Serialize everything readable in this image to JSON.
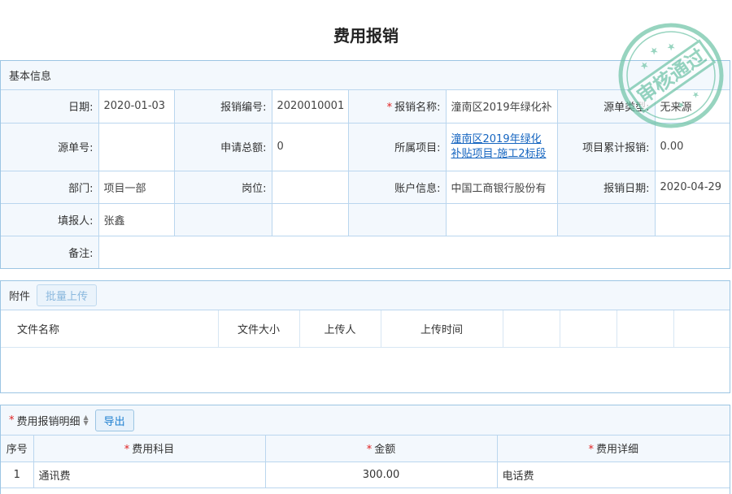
{
  "page": {
    "title": "费用报销"
  },
  "basic": {
    "header": "基本信息",
    "date_label": "日期:",
    "date": "2020-01-03",
    "number_label": "报销编号:",
    "number": "2020010001",
    "name_label": "报销名称:",
    "name": "潼南区2019年绿化补",
    "src_type_label": "源单类型:",
    "src_type": "无来源",
    "src_no_label": "源单号:",
    "src_no": "",
    "total_label": "申请总额:",
    "total": "0",
    "project_label": "所属项目:",
    "project": "潼南区2019年绿化补贴项目-施工2标段",
    "cumulative_label": "项目累计报销:",
    "cumulative": "0.00",
    "dept_label": "部门:",
    "dept": "项目一部",
    "post_label": "岗位:",
    "post": "",
    "account_label": "账户信息:",
    "account": "中国工商银行股份有",
    "reimb_date_label": "报销日期:",
    "reimb_date": "2020-04-29",
    "filler_label": "填报人:",
    "filler": "张鑫",
    "remark_label": "备注:",
    "remark": ""
  },
  "attachments": {
    "header": "附件",
    "upload_button": "批量上传",
    "columns": [
      "文件名称",
      "文件大小",
      "上传人",
      "上传时间"
    ]
  },
  "details": {
    "header": "费用报销明细",
    "export_button": "导出",
    "columns": {
      "seq": "序号",
      "subject": "费用科目",
      "amount": "金额",
      "detail": "费用详细"
    },
    "rows": [
      {
        "seq": "1",
        "subject": "通讯费",
        "amount": "300.00",
        "detail": "电话费"
      }
    ]
  },
  "stamp": {
    "text": "审核通过",
    "color": "#6cc2a5"
  },
  "colors": {
    "border": "#9cc5e3",
    "label_bg": "#f3f8fd",
    "link": "#1565c0",
    "required": "#e02020"
  }
}
